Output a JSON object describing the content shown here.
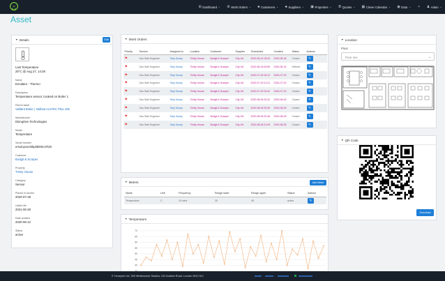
{
  "nav": {
    "items": [
      {
        "icon": "dashboard-icon",
        "glyph": "⊞",
        "label": "Dashboard"
      },
      {
        "icon": "wrench-icon",
        "glyph": "⚙",
        "label": "Work Orders"
      },
      {
        "icon": "customers-icon",
        "glyph": "♣",
        "label": "Customers"
      },
      {
        "icon": "suppliers-icon",
        "glyph": "♣",
        "label": "Suppliers"
      },
      {
        "icon": "building-icon",
        "glyph": "▣",
        "label": "Properties"
      },
      {
        "icon": "quotes-icon",
        "glyph": "≣",
        "label": "Quotes"
      },
      {
        "icon": "calendar-icon",
        "glyph": "▦",
        "label": "Clever Calendar"
      },
      {
        "icon": "eye-icon",
        "glyph": "◉",
        "label": "Data"
      },
      {
        "icon": "settings-icon",
        "glyph": "✧",
        "label": ""
      },
      {
        "icon": "user-icon",
        "glyph": "♟",
        "label": "Adam"
      }
    ]
  },
  "page": {
    "title": "Asset"
  },
  "details": {
    "header": "Details",
    "edit": "Edit",
    "last_temp_label": "Last Temperature",
    "last_temp_value": "28°C @ Aug 27, 14:28",
    "name_label": "Name",
    "name_value": "Emulator - Thermo",
    "desc_label": "Description",
    "desc_value": "Temperature sensor, located on Boiler 1",
    "parent_label": "Parent asset",
    "parent_value": "Vaillant Boiler | Vaillant ecoTEC Plus 435",
    "manu_label": "Manufacturer",
    "manu_value": "Disruptive Technologies",
    "model_label": "Model",
    "model_value": "Temperature",
    "serial_label": "Serial Number",
    "serial_value": "emulcpceel4kpld000c37t20",
    "customer_label": "Customer",
    "customer_value": "Bodgit & Scarper",
    "property_label": "Property",
    "property_value": "Trinity House",
    "category_label": "Category",
    "category_value": "Sensor",
    "placed_label": "Placed in service",
    "placed_value": "2020-07-28",
    "life_label": "Useful life",
    "life_value": "2021-06-30",
    "created_label": "Date created",
    "created_value": "2020-06-12",
    "status_label": "Status",
    "status_value": "active"
  },
  "work_orders": {
    "header": "Work Orders",
    "columns": [
      "Priority",
      "Service",
      "Assigned to",
      "Location",
      "Customer",
      "Supplier",
      "Scheduled",
      "Created",
      "Status",
      "Actions"
    ],
    "rows": [
      {
        "service": "Gas Safe Engineer",
        "assigned": "Toby Kooey",
        "location": "Trinity House",
        "customer": "Bodgit & Scarper",
        "supplier": "City Lift",
        "scheduled": "2020-08-16 18:23",
        "created": "2020-08-18",
        "status": "Closed"
      },
      {
        "service": "Gas Safe Engineer",
        "assigned": "Toby Kooey",
        "location": "Trinity House",
        "customer": "Bodgit & Scarper",
        "supplier": "City Lift",
        "scheduled": "2020-08-18 09:59",
        "created": "2020-08-18",
        "status": "Offered"
      },
      {
        "service": "Gas Safe Engineer",
        "assigned": "Toby Kooey",
        "location": "Trinity House",
        "customer": "Bodgit & Scarper",
        "supplier": "City Lift",
        "scheduled": "2020-07-28 18:12",
        "created": "2020-07-29",
        "status": "Closed"
      },
      {
        "service": "Gas Safe Engineer",
        "assigned": "Toby Kooey",
        "location": "Trinity House",
        "customer": "Bodgit & Scarper",
        "supplier": "City Lift",
        "scheduled": "2020-07-29 21:31",
        "created": "2020-07-29",
        "status": "Closed"
      },
      {
        "service": "Gas Safe Engineer",
        "assigned": "Toby Kooey",
        "location": "Trinity House",
        "customer": "Bodgit & Scarper",
        "supplier": "City Lift",
        "scheduled": "2020-07-29 20:42",
        "created": "2020-07-29",
        "status": "Closed"
      },
      {
        "service": "Gas Safe Engineer",
        "assigned": "Toby Kooey",
        "location": "Trinity House",
        "customer": "Bodgit & Scarper",
        "supplier": "City Lift",
        "scheduled": "2020-08-06 20:24",
        "created": "2020-08-06",
        "status": "Closed"
      },
      {
        "service": "Gas Safe Engineer",
        "assigned": "Toby Kooey",
        "location": "Trinity House",
        "customer": "Bodgit & Scarper",
        "supplier": "City Lift",
        "scheduled": "2020-08-05 20:39",
        "created": "2020-08-05",
        "status": "Closed"
      },
      {
        "service": "Gas Safe Engineer",
        "assigned": "Toby Kooey",
        "location": "Trinity House",
        "customer": "Bodgit & Scarper",
        "supplier": "City Lift",
        "scheduled": "2020-08-05 20:48",
        "created": "2020-08-05",
        "status": "Closed"
      },
      {
        "service": "Gas Safe Engineer",
        "assigned": "Toby Kooey",
        "location": "Trinity House",
        "customer": "Bodgit & Scarper",
        "supplier": "City Lift",
        "scheduled": "2020-08-08 21:09",
        "created": "2020-08-08",
        "status": "Closed"
      }
    ]
  },
  "meters": {
    "header": "Meters",
    "add": "Add Meter",
    "columns": [
      "Name",
      "Unit",
      "Frequency",
      "Range lower",
      "Range upper",
      "Status",
      "Actions"
    ],
    "rows": [
      {
        "name": "Temperature",
        "unit": "C",
        "frequency": "15 mins",
        "lower": "25",
        "upper": "45",
        "status": "active"
      }
    ]
  },
  "temperature": {
    "header": "Temperature"
  },
  "location": {
    "header": "Location",
    "floor_label": "Floor",
    "floor_placeholder": "Floor one"
  },
  "qr": {
    "header": "QR Code",
    "download": "Download"
  },
  "footer": {
    "text": "© Honeyee Ltd. 309 Westbourne Studios, 242 Acklam Road, London W10 5JJ"
  },
  "chart_data": {
    "type": "line",
    "title": "",
    "ylabel": "",
    "yticks": [
      70,
      65,
      60,
      55,
      50,
      45,
      40,
      35
    ],
    "ylim": [
      33,
      73
    ],
    "series": [
      {
        "color": "#f2b07a",
        "values": [
          40,
          47,
          44,
          58,
          48,
          62,
          45,
          60,
          39,
          67,
          50,
          58,
          42,
          65,
          47,
          61,
          41,
          69,
          52,
          63,
          38,
          56,
          48,
          66,
          43,
          59,
          45,
          70,
          40,
          54,
          49,
          63,
          37,
          61,
          46,
          57
        ]
      }
    ]
  }
}
